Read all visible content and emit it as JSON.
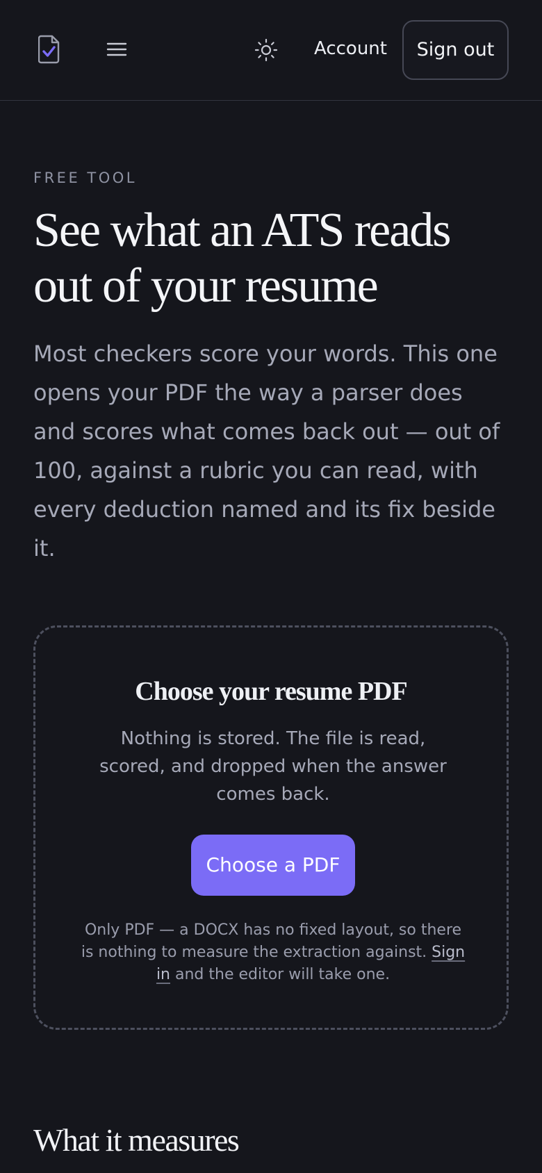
{
  "header": {
    "logo_icon": "document-check-icon",
    "menu_icon": "hamburger-menu-icon",
    "theme_icon": "sun-icon",
    "account_label": "Account",
    "signout_label": "Sign out"
  },
  "hero": {
    "eyebrow": "FREE TOOL",
    "title_line1": "See what an ATS reads",
    "title_line2": "out of your resume",
    "lead": "Most checkers score your words. This one opens your PDF the way a parser does and scores what comes back out — out of 100, against a rubric you can read, with every deduction named and its fix beside it."
  },
  "upload": {
    "title": "Choose your resume PDF",
    "description": "Nothing is stored. The file is read, scored, and dropped when the answer comes back.",
    "button_label": "Choose a PDF",
    "note_before": "Only PDF — a DOCX has no fixed layout, so there is nothing to measure the extraction against. ",
    "note_link": "Sign in",
    "note_after": " and the editor will take one."
  },
  "section": {
    "title": "What it measures"
  },
  "colors": {
    "background": "#15161c",
    "accent": "#7b6cf6",
    "muted_text": "#a6a9b8"
  }
}
